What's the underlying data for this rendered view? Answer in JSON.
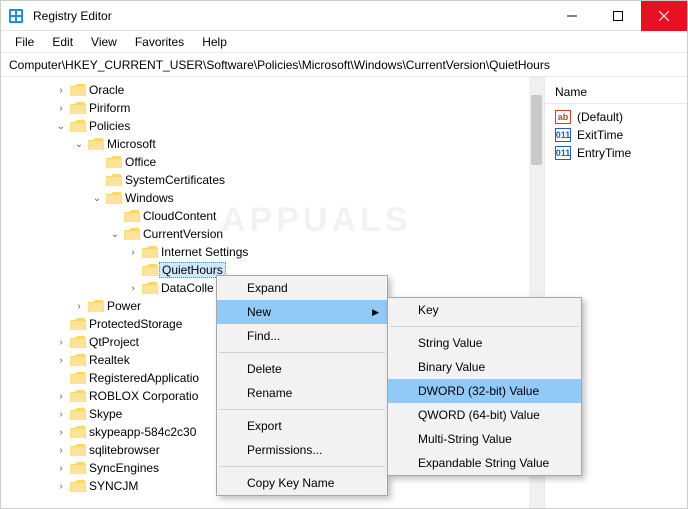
{
  "window": {
    "title": "Registry Editor"
  },
  "menu": {
    "file": "File",
    "edit": "Edit",
    "view": "View",
    "fav": "Favorites",
    "help": "Help"
  },
  "address": "Computer\\HKEY_CURRENT_USER\\Software\\Policies\\Microsoft\\Windows\\CurrentVersion\\QuietHours",
  "tree": {
    "oracle": "Oracle",
    "piriform": "Piriform",
    "policies": "Policies",
    "microsoft": "Microsoft",
    "office": "Office",
    "syscert": "SystemCertificates",
    "windows": "Windows",
    "cloud": "CloudContent",
    "curver": "CurrentVersion",
    "inet": "Internet Settings",
    "quiet": "QuietHours",
    "datacolle": "DataColle",
    "power": "Power",
    "protected": "ProtectedStorage",
    "qt": "QtProject",
    "realtek": "Realtek",
    "regapp": "RegisteredApplicatio",
    "roblox": "ROBLOX Corporatio",
    "skype": "Skype",
    "skypeapp": "skypeapp-584c2c30",
    "sqlite": "sqlitebrowser",
    "synceng": "SyncEngines",
    "syncjm": "SYNCJM"
  },
  "values": {
    "header": "Name",
    "default": "(Default)",
    "exit": "ExitTime",
    "entry": "EntryTime"
  },
  "cm1": {
    "expand": "Expand",
    "new": "New",
    "find": "Find...",
    "delete": "Delete",
    "rename": "Rename",
    "export": "Export",
    "perm": "Permissions...",
    "copy": "Copy Key Name"
  },
  "cm2": {
    "key": "Key",
    "string": "String Value",
    "binary": "Binary Value",
    "dword": "DWORD (32-bit) Value",
    "qword": "QWORD (64-bit) Value",
    "multi": "Multi-String Value",
    "exp": "Expandable String Value"
  }
}
